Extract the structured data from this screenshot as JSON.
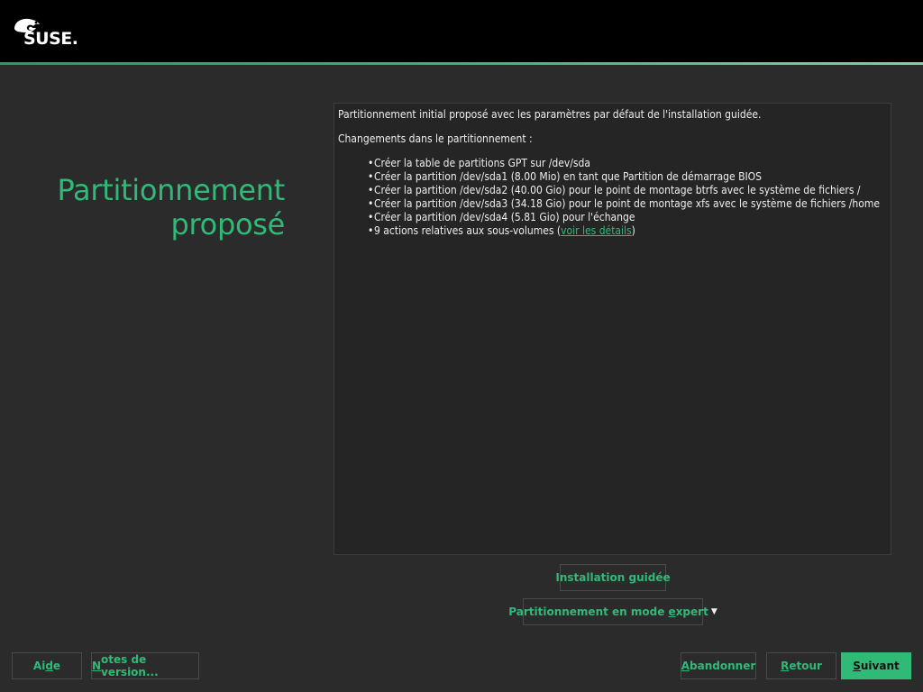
{
  "header": {
    "logo_text": "SUSE."
  },
  "page": {
    "title_line1": "Partitionnement",
    "title_line2": "proposé"
  },
  "summary": {
    "intro": "Partitionnement initial proposé avec les paramètres par défaut de l'installation guidée.",
    "changes_heading": "Changements dans le partitionnement :",
    "items": [
      "Créer la table de partitions GPT sur /dev/sda",
      "Créer la partition /dev/sda1 (8.00 Mio) en tant que Partition de démarrage BIOS",
      "Créer la partition /dev/sda2 (40.00 Gio) pour le point de montage btrfs avec le système de fichiers /",
      "Créer la partition /dev/sda3 (34.18 Gio) pour le point de montage xfs avec le système de fichiers /home",
      "Créer la partition /dev/sda4 (5.81 Gio) pour l'échange"
    ],
    "subvolumes_prefix": "9 actions relatives aux sous-volumes (",
    "subvolumes_link": "voir les détails",
    "subvolumes_suffix": ")"
  },
  "buttons": {
    "guided_a": "Installation ",
    "guided_u": "g",
    "guided_b": "uidée",
    "expert_a": "Partitionnement en mode ",
    "expert_u": "e",
    "expert_b": "xpert",
    "help_a": "Ai",
    "help_u": "d",
    "help_b": "e",
    "notes_u": "N",
    "notes_b": "otes de version...",
    "abort_u": "A",
    "abort_b": "bandonner",
    "back_u": "R",
    "back_b": "etour",
    "next_u": "S",
    "next_b": "uivant"
  },
  "colors": {
    "accent": "#30ba78",
    "background": "#2b2b2b",
    "panel": "#252525",
    "topbar": "#000000"
  }
}
